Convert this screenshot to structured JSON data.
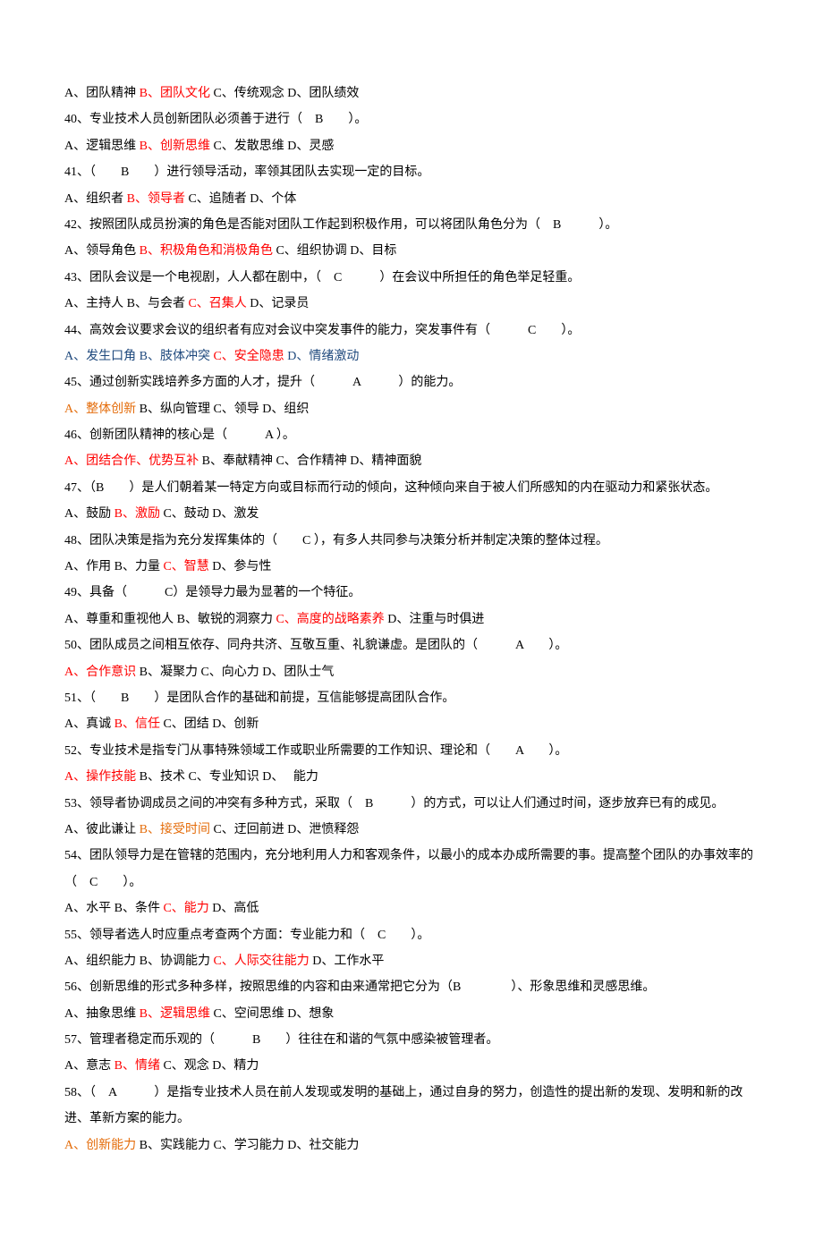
{
  "lines": [
    {
      "parts": [
        {
          "t": "A、团队精神 ",
          "c": ""
        },
        {
          "t": "B、团队文化 ",
          "c": "red"
        },
        {
          "t": "C、传统观念 D、团队绩效",
          "c": ""
        }
      ]
    },
    {
      "parts": [
        {
          "t": "40、专业技术人员创新团队必须善于进行（　B　　）。",
          "c": ""
        }
      ]
    },
    {
      "parts": [
        {
          "t": "A、逻辑思维 ",
          "c": ""
        },
        {
          "t": "B、创新思维 ",
          "c": "red"
        },
        {
          "t": "C、发散思维 D、灵感",
          "c": ""
        }
      ]
    },
    {
      "parts": [
        {
          "t": "41、（　　B　　）进行领导活动，率领其团队去实现一定的目标。",
          "c": ""
        }
      ]
    },
    {
      "parts": [
        {
          "t": "A、组织者 ",
          "c": ""
        },
        {
          "t": "B、领导者 ",
          "c": "red"
        },
        {
          "t": "C、追随者 D、个体",
          "c": ""
        }
      ]
    },
    {
      "parts": [
        {
          "t": "42、按照团队成员扮演的角色是否能对团队工作起到积极作用，可以将团队角色分为（　B　　　）。",
          "c": ""
        }
      ]
    },
    {
      "parts": [
        {
          "t": "A、领导角色 ",
          "c": ""
        },
        {
          "t": "B、积极角色和消极角色 ",
          "c": "red"
        },
        {
          "t": "C、组织协调 D、目标",
          "c": ""
        }
      ]
    },
    {
      "parts": [
        {
          "t": "43、团队会议是一个电视剧，人人都在剧中，（　C　　　）在会议中所担任的角色举足轻重。",
          "c": ""
        }
      ]
    },
    {
      "parts": [
        {
          "t": "A、主持人 B、与会者 ",
          "c": ""
        },
        {
          "t": "C、召集人 ",
          "c": "red"
        },
        {
          "t": "D、记录员",
          "c": ""
        }
      ]
    },
    {
      "parts": [
        {
          "t": "44、高效会议要求会议的组织者有应对会议中突发事件的能力，突发事件有（　　　C　　）。",
          "c": ""
        }
      ]
    },
    {
      "parts": [
        {
          "t": "A、发生口角 B、肢体冲突 ",
          "c": "blue"
        },
        {
          "t": "C、安全隐患 ",
          "c": "red"
        },
        {
          "t": "D、情绪激动",
          "c": "blue"
        }
      ]
    },
    {
      "parts": [
        {
          "t": "45、通过创新实践培养多方面的人才，提升（　　　A　　　）的能力。",
          "c": ""
        }
      ]
    },
    {
      "parts": [
        {
          "t": "A、整体创新 ",
          "c": "orange"
        },
        {
          "t": "B、纵向管理 C、领导 D、组织",
          "c": ""
        }
      ]
    },
    {
      "parts": [
        {
          "t": "46、创新团队精神的核心是（　　　A ）。",
          "c": ""
        }
      ]
    },
    {
      "parts": [
        {
          "t": "A、团结合作、优势互补 ",
          "c": "red"
        },
        {
          "t": "B、奉献精神 C、合作精神 D、精神面貌",
          "c": ""
        }
      ]
    },
    {
      "parts": [
        {
          "t": "47、（B　　）是人们朝着某一特定方向或目标而行动的倾向，这种倾向来自于被人们所感知的内在驱动力和紧张状态。",
          "c": ""
        }
      ]
    },
    {
      "parts": [
        {
          "t": "A、鼓励 ",
          "c": ""
        },
        {
          "t": "B、激励 ",
          "c": "red"
        },
        {
          "t": "C、鼓动 D、激发",
          "c": ""
        }
      ]
    },
    {
      "parts": [
        {
          "t": "48、团队决策是指为充分发挥集体的（　　C ），有多人共同参与决策分析并制定决策的整体过程。",
          "c": ""
        }
      ]
    },
    {
      "parts": [
        {
          "t": "A、作用 B、力量 ",
          "c": ""
        },
        {
          "t": "C、智慧 ",
          "c": "red"
        },
        {
          "t": "D、参与性",
          "c": ""
        }
      ]
    },
    {
      "parts": [
        {
          "t": "49、具备（　　　C）是领导力最为显著的一个特征。",
          "c": ""
        }
      ]
    },
    {
      "parts": [
        {
          "t": "A、尊重和重视他人 B、敏锐的洞察力 ",
          "c": ""
        },
        {
          "t": "C、高度的战略素养 ",
          "c": "red"
        },
        {
          "t": "D、注重与时俱进",
          "c": ""
        }
      ]
    },
    {
      "parts": [
        {
          "t": "50、团队成员之间相互依存、同舟共济、互敬互重、礼貌谦虚。是团队的（　　　A　　）。",
          "c": ""
        }
      ]
    },
    {
      "parts": [
        {
          "t": "A、合作意识 ",
          "c": "red"
        },
        {
          "t": "B、凝聚力 C、向心力 D、团队士气",
          "c": ""
        }
      ]
    },
    {
      "parts": [
        {
          "t": "51、（　　B　　）是团队合作的基础和前提，互信能够提高团队合作。",
          "c": ""
        }
      ]
    },
    {
      "parts": [
        {
          "t": "A、真诚 ",
          "c": ""
        },
        {
          "t": "B、信任 ",
          "c": "red"
        },
        {
          "t": "C、团结 D、创新",
          "c": ""
        }
      ]
    },
    {
      "parts": [
        {
          "t": "52、专业技术是指专门从事特殊领域工作或职业所需要的工作知识、理论和（　　A　　）。",
          "c": ""
        }
      ]
    },
    {
      "parts": [
        {
          "t": "A、操作技能 ",
          "c": "red"
        },
        {
          "t": "B、技术 C、专业知识 D、　 能力",
          "c": ""
        }
      ]
    },
    {
      "parts": [
        {
          "t": "53、领导者协调成员之间的冲突有多种方式，采取（　B　　　）的方式，可以让人们通过时间，逐步放弃已有的成见。",
          "c": ""
        }
      ]
    },
    {
      "parts": [
        {
          "t": "A、彼此谦让 ",
          "c": ""
        },
        {
          "t": "B、接受时间 ",
          "c": "orange"
        },
        {
          "t": "C、迂回前进 D、泄愤释怨",
          "c": ""
        }
      ]
    },
    {
      "parts": [
        {
          "t": "54、团队领导力是在管辖的范围内，充分地利用人力和客观条件，以最小的成本办成所需要的事。提高整个团队的办事效率的（　C　　）。",
          "c": ""
        }
      ]
    },
    {
      "parts": [
        {
          "t": "A、水平 B、条件 ",
          "c": ""
        },
        {
          "t": "C、能力 ",
          "c": "red"
        },
        {
          "t": "D、高低",
          "c": ""
        }
      ]
    },
    {
      "parts": [
        {
          "t": "55、领导者选人时应重点考查两个方面：专业能力和（　C　　）。",
          "c": ""
        }
      ]
    },
    {
      "parts": [
        {
          "t": "A、组织能力 B、协调能力 ",
          "c": ""
        },
        {
          "t": "C、人际交往能力 ",
          "c": "red"
        },
        {
          "t": "D、工作水平",
          "c": ""
        }
      ]
    },
    {
      "parts": [
        {
          "t": "56、创新思维的形式多种多样，按照思维的内容和由来通常把它分为（B　　　　）、形象思维和灵感思维。",
          "c": ""
        }
      ]
    },
    {
      "parts": [
        {
          "t": "A、抽象思维 ",
          "c": ""
        },
        {
          "t": "B、逻辑思维 ",
          "c": "red"
        },
        {
          "t": "C、空间思维 D、想象",
          "c": ""
        }
      ]
    },
    {
      "parts": [
        {
          "t": "57、管理者稳定而乐观的（　　　B　　）往往在和谐的气氛中感染被管理者。",
          "c": ""
        }
      ]
    },
    {
      "parts": [
        {
          "t": "A、意志 ",
          "c": ""
        },
        {
          "t": "B、情绪 ",
          "c": "red"
        },
        {
          "t": "C、观念 D、精力",
          "c": ""
        }
      ]
    },
    {
      "parts": [
        {
          "t": "58、（　A　　　）是指专业技术人员在前人发现或发明的基础上，通过自身的努力，创造性的提出新的发现、发明和新的改进、革新方案的能力。",
          "c": ""
        }
      ]
    },
    {
      "parts": [
        {
          "t": "A、创新能力 ",
          "c": "orange"
        },
        {
          "t": "B、实践能力 C、学习能力 D、社交能力",
          "c": ""
        }
      ]
    }
  ]
}
